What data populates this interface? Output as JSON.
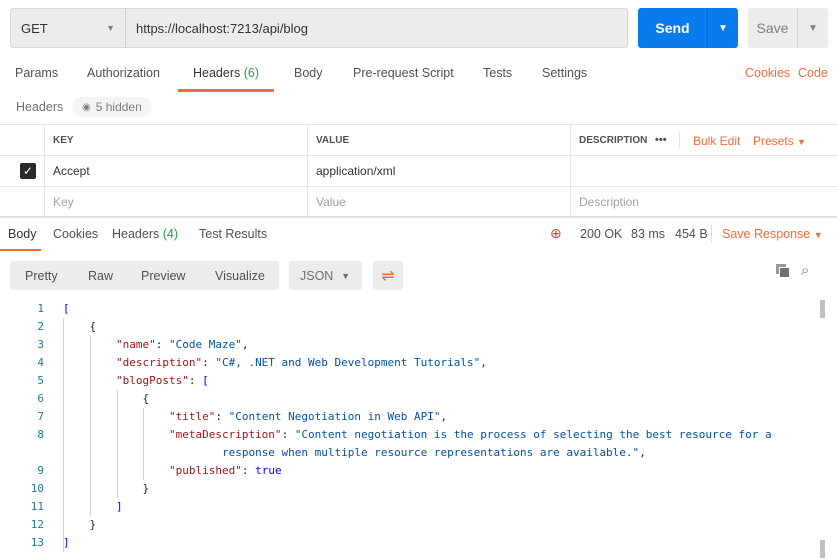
{
  "request": {
    "method": "GET",
    "url": "https://localhost:7213/api/blog",
    "send_label": "Send",
    "save_label": "Save"
  },
  "tabs": [
    {
      "label": "Params"
    },
    {
      "label": "Authorization"
    },
    {
      "label": "Headers",
      "count": "(6)"
    },
    {
      "label": "Body"
    },
    {
      "label": "Pre-request Script"
    },
    {
      "label": "Tests"
    },
    {
      "label": "Settings"
    }
  ],
  "links": {
    "cookies": "Cookies",
    "code": "Code"
  },
  "headers": {
    "label": "Headers",
    "hidden": "5 hidden",
    "columns": {
      "key": "KEY",
      "value": "VALUE",
      "description": "DESCRIPTION",
      "more": "•••",
      "bulk_edit": "Bulk Edit",
      "presets": "Presets"
    },
    "rows": [
      {
        "checked": true,
        "key": "Accept",
        "value": "application/xml",
        "description": ""
      }
    ],
    "placeholder": {
      "key": "Key",
      "value": "Value",
      "description": "Description"
    }
  },
  "response": {
    "tabs": [
      {
        "label": "Body"
      },
      {
        "label": "Cookies"
      },
      {
        "label": "Headers",
        "count": "(4)"
      },
      {
        "label": "Test Results"
      }
    ],
    "status": "200 OK",
    "time": "83 ms",
    "size": "454 B",
    "save_response": "Save Response",
    "views": [
      "Pretty",
      "Raw",
      "Preview",
      "Visualize"
    ],
    "format": "JSON"
  },
  "code_lines": [
    {
      "n": "1",
      "html": "<span class='b'>[</span>"
    },
    {
      "n": "2",
      "html": "    {"
    },
    {
      "n": "3",
      "html": "        <span class='k'>\"name\"</span>: <span class='s'>\"Code Maze\"</span>,"
    },
    {
      "n": "4",
      "html": "        <span class='k'>\"description\"</span>: <span class='s'>\"C#, .NET and Web Development Tutorials\"</span>,"
    },
    {
      "n": "5",
      "html": "        <span class='k'>\"blogPosts\"</span>: <span class='b'>[</span>"
    },
    {
      "n": "6",
      "html": "            {"
    },
    {
      "n": "7",
      "html": "                <span class='k'>\"title\"</span>: <span class='s'>\"Content Negotiation in Web API\"</span>,"
    },
    {
      "n": "8",
      "html": "                <span class='k'>\"metaDescription\"</span>: <span class='s'>\"Content negotiation is the process of selecting the best resource for a</span>"
    },
    {
      "n": "",
      "html": "                        <span class='s'>response when multiple resource representations are available.\"</span>,"
    },
    {
      "n": "9",
      "html": "                <span class='k'>\"published\"</span>: <span class='b'>true</span>"
    },
    {
      "n": "10",
      "html": "            }"
    },
    {
      "n": "11",
      "html": "        <span class='b'>]</span>"
    },
    {
      "n": "12",
      "html": "    }"
    },
    {
      "n": "13",
      "html": "<span class='b'>]</span>"
    }
  ]
}
